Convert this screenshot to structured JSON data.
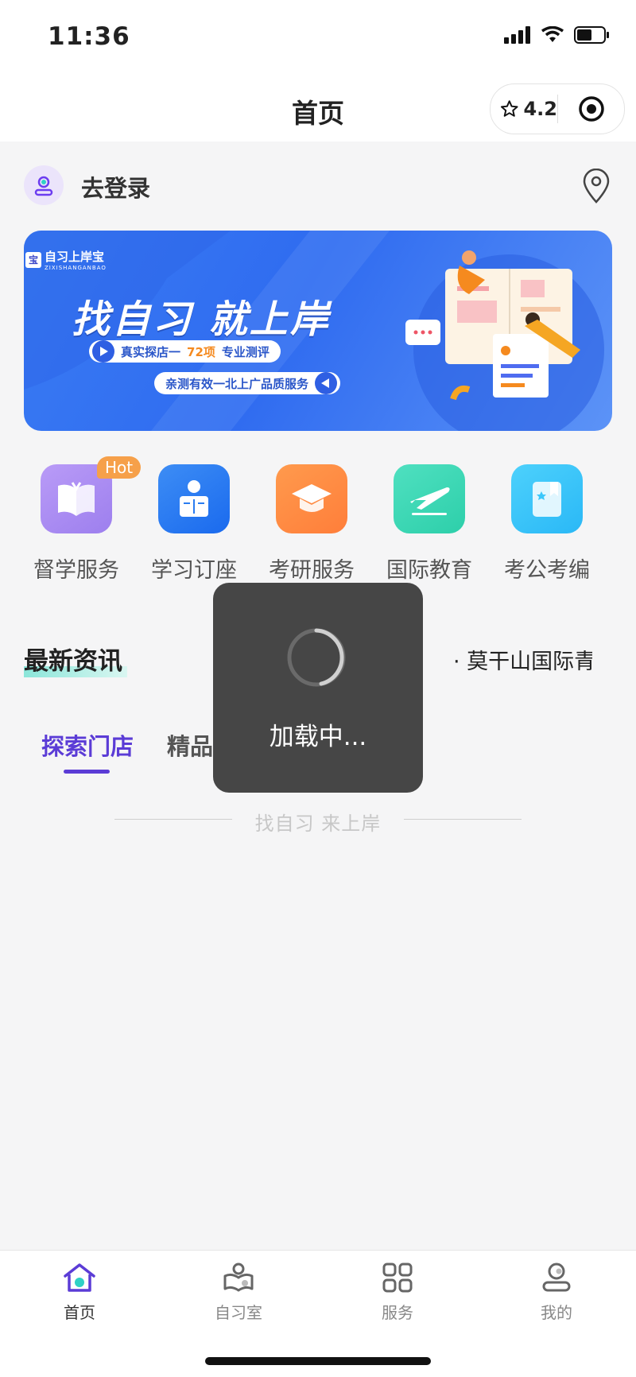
{
  "status_bar": {
    "time": "11:36"
  },
  "navbar": {
    "title": "首页",
    "rating": "4.2"
  },
  "login": {
    "text": "去登录"
  },
  "banner": {
    "logo_text": "自习上岸宝",
    "logo_sub": "ZIXISHANGANBAO",
    "headline": "找自习 就上岸",
    "pill1_pre": "真实探店一",
    "pill1_num": "72项",
    "pill1_post": "专业测评",
    "pill2": "亲测有效一北上广品质服务"
  },
  "services": [
    {
      "label": "督学服务",
      "icon": "book-open-icon",
      "badge": "Hot",
      "color": "#a98cf0"
    },
    {
      "label": "学习订座",
      "icon": "reading-person-icon",
      "color": "#2a7cf0"
    },
    {
      "label": "考研服务",
      "icon": "graduation-cap-icon",
      "color": "#ff8a3d"
    },
    {
      "label": "国际教育",
      "icon": "airplane-icon",
      "color": "#3bd8b8"
    },
    {
      "label": "考公考编",
      "icon": "bookmark-star-icon",
      "color": "#3cc8fb"
    }
  ],
  "news": {
    "title": "最新资讯",
    "ticker": "· 莫干山国际青"
  },
  "tabs": {
    "active": "探索门店",
    "second": "精品"
  },
  "slogan": "找自习 来上岸",
  "toast": {
    "message": "加载中..."
  },
  "tabbar": [
    {
      "label": "首页",
      "icon": "home-icon",
      "active": true
    },
    {
      "label": "自习室",
      "icon": "study-room-icon",
      "active": false
    },
    {
      "label": "服务",
      "icon": "grid-icon",
      "active": false
    },
    {
      "label": "我的",
      "icon": "profile-icon",
      "active": false
    }
  ],
  "colors": {
    "accent": "#5b3cd6",
    "banner": "#3a7cf3",
    "hot_badge": "#f6a04a"
  }
}
